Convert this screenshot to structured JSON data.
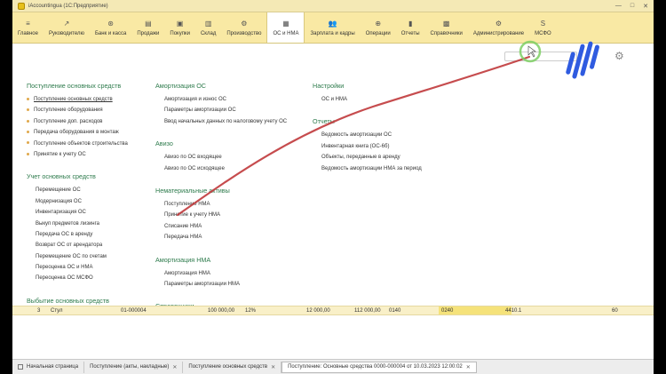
{
  "window": {
    "title": "iAccountingua  (1С:Предприятие)",
    "controls": [
      "—",
      "□",
      "✕"
    ]
  },
  "sections": [
    {
      "label": "Главное",
      "icon": "hamburger-icon",
      "glyph": "≡"
    },
    {
      "label": "Руководителю",
      "icon": "trend-icon",
      "glyph": "↗"
    },
    {
      "label": "Банк и касса",
      "icon": "bank-icon",
      "glyph": "⊛"
    },
    {
      "label": "Продажи",
      "icon": "sales-icon",
      "glyph": "▤"
    },
    {
      "label": "Покупки",
      "icon": "cart-icon",
      "glyph": "▣"
    },
    {
      "label": "Склад",
      "icon": "warehouse-icon",
      "glyph": "▥"
    },
    {
      "label": "Производство",
      "icon": "factory-icon",
      "glyph": "⚙"
    },
    {
      "label": "ОС и НМА",
      "icon": "assets-icon",
      "glyph": "▦",
      "active": true
    },
    {
      "label": "Зарплата и кадры",
      "icon": "people-icon",
      "glyph": "👥"
    },
    {
      "label": "Операции",
      "icon": "operations-icon",
      "glyph": "⊕"
    },
    {
      "label": "Отчеты",
      "icon": "reports-icon",
      "glyph": "▮"
    },
    {
      "label": "Справочники",
      "icon": "books-icon",
      "glyph": "▩"
    },
    {
      "label": "Администрирование",
      "icon": "admin-gear-icon",
      "glyph": "⚙"
    },
    {
      "label": "МСФО",
      "icon": "msfo-icon",
      "glyph": "S"
    }
  ],
  "panel": {
    "col1": {
      "groups": [
        {
          "title": "Поступление основных средств",
          "items": [
            {
              "label": "Поступление основных средств",
              "bullet": true,
              "selected": true
            },
            {
              "label": "Поступление оборудования",
              "bullet": true
            },
            {
              "label": "Поступление доп. расходов",
              "bullet": true
            },
            {
              "label": "Передача оборудования в монтаж",
              "bullet": true
            },
            {
              "label": "Поступление объектов строительства",
              "bullet": true
            },
            {
              "label": "Принятие к учету ОС",
              "bullet": true
            }
          ]
        },
        {
          "title": "Учет основных средств",
          "items": [
            {
              "label": "Перемещение ОС"
            },
            {
              "label": "Модернизация ОС"
            },
            {
              "label": "Инвентаризация ОС"
            },
            {
              "label": "Выкуп предметов лизинга"
            },
            {
              "label": "Передача ОС в аренду"
            },
            {
              "label": "Возврат ОС от арендатора"
            },
            {
              "label": "Перемещение ОС по счетам"
            },
            {
              "label": "Переоценка ОС и НМА"
            },
            {
              "label": "Переоценка ОС МСФО"
            }
          ]
        },
        {
          "title": "Выбытие основных средств",
          "items": []
        }
      ]
    },
    "col2": {
      "groups": [
        {
          "title": "Амортизация ОС",
          "items": [
            {
              "label": "Амортизация и износ ОС"
            },
            {
              "label": "Параметры амортизации ОС"
            },
            {
              "label": "Ввод начальных данных по налоговому учету ОС"
            }
          ]
        },
        {
          "title": "Авизо",
          "items": [
            {
              "label": "Авизо по ОС входящее"
            },
            {
              "label": "Авизо по ОС исходящее"
            }
          ]
        },
        {
          "title": "Нематериальные активы",
          "items": [
            {
              "label": "Поступление НМА"
            },
            {
              "label": "Принятие к учету НМА"
            },
            {
              "label": "Списание НМА"
            },
            {
              "label": "Передача НМА"
            }
          ]
        },
        {
          "title": "Амортизация НМА",
          "items": [
            {
              "label": "Амортизация НМА"
            },
            {
              "label": "Параметры амортизации НМА"
            }
          ]
        },
        {
          "title": "Справочники",
          "items": []
        }
      ]
    },
    "col3": {
      "groups": [
        {
          "title": "Настройки",
          "items": [
            {
              "label": "ОС и НМА"
            }
          ]
        },
        {
          "title": "Отчеты",
          "items": [
            {
              "label": "Ведомость амортизации ОС"
            },
            {
              "label": "Инвентарная книга (ОС-6б)"
            },
            {
              "label": "Объекты, переданные в аренду"
            },
            {
              "label": "Ведомость амортизации НМА за период"
            }
          ]
        }
      ]
    }
  },
  "table_row": {
    "num": "3",
    "name": "Стул",
    "code": "01-000004",
    "sum": "100 000,00",
    "vat": "12%",
    "vat_sum": "12 000,00",
    "total": "112 000,00",
    "acc1": "0140",
    "acc2": "0240",
    "acc3": "4410.1",
    "qty": "60"
  },
  "taskbar": [
    {
      "label": "Начальная страница",
      "home": true
    },
    {
      "label": "Поступление (акты, накладные)",
      "close": "✕"
    },
    {
      "label": "Поступление основных средств",
      "close": "✕"
    },
    {
      "label": "Поступление: Основные средства 0000-000004 от 10.03.2023 12:00:02",
      "close": "✕",
      "active": true
    }
  ],
  "colors": {
    "section_bar": "#f9e9a4",
    "group_title": "#2c7a4b",
    "cursor_ring": "#7ccf63",
    "stroke": "#c0393b",
    "logo_blue": "#2f5be0"
  }
}
